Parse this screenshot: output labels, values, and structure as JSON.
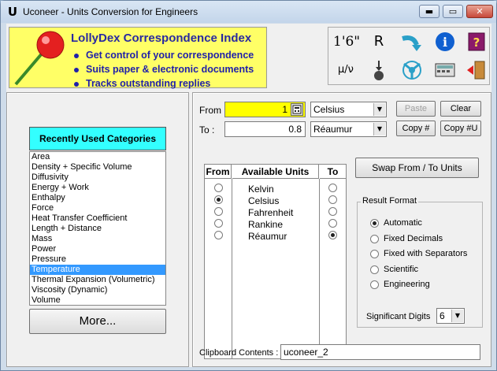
{
  "window": {
    "title": "Uconeer - Units Conversion for Engineers",
    "app_icon": "U",
    "controls": {
      "minimize": "▬",
      "maximize": "▭",
      "close": "✕"
    }
  },
  "banner": {
    "title": "LollyDex Correspondence Index",
    "items": [
      "Get control of your correspondence",
      "Suits paper & electronic documents",
      "Tracks outstanding replies"
    ]
  },
  "toolbar": {
    "icons": [
      {
        "name": "feet-inches-icon",
        "glyph": "1'6\""
      },
      {
        "name": "r-icon",
        "glyph": "R"
      },
      {
        "name": "curved-arrow-icon",
        "glyph": ""
      },
      {
        "name": "info-icon",
        "glyph": "i"
      },
      {
        "name": "help-book-icon",
        "glyph": "?"
      },
      {
        "name": "mu-over-nu-icon",
        "glyph": "μ/ν"
      },
      {
        "name": "pressure-gauge-icon",
        "glyph": ""
      },
      {
        "name": "fan-icon",
        "glyph": ""
      },
      {
        "name": "calculator-icon",
        "glyph": ""
      },
      {
        "name": "exit-icon",
        "glyph": ""
      }
    ]
  },
  "categories": {
    "header": "Recently Used Categories",
    "items": [
      "Area",
      "Density + Specific Volume",
      "Diffusivity",
      "Energy + Work",
      "Enthalpy",
      "Force",
      "Heat Transfer Coefficient",
      "Length + Distance",
      "Mass",
      "Power",
      "Pressure",
      "Temperature",
      "Thermal Expansion (Volumetric)",
      "Viscosity (Dynamic)",
      "Volume"
    ],
    "selected": "Temperature",
    "more_label": "More..."
  },
  "conversion": {
    "from_label": "From",
    "to_label": "To :",
    "from_value": "1",
    "to_value": "0.8",
    "from_unit": "Celsius",
    "to_unit": "Réaumur",
    "paste_label": "Paste",
    "clear_label": "Clear",
    "copy_label": "Copy #",
    "copy_u_label": "Copy #U",
    "from_color": "#ffff00"
  },
  "units": {
    "col_from": "From",
    "col_units": "Available Units",
    "col_to": "To",
    "items": [
      {
        "name": "Kelvin",
        "from": false,
        "to": false
      },
      {
        "name": "Celsius",
        "from": true,
        "to": false
      },
      {
        "name": "Fahrenheit",
        "from": false,
        "to": false
      },
      {
        "name": "Rankine",
        "from": false,
        "to": false
      },
      {
        "name": "Réaumur",
        "from": false,
        "to": true
      }
    ]
  },
  "swap": {
    "label": "Swap  From / To  Units"
  },
  "result_format": {
    "title": "Result Format",
    "options": [
      "Automatic",
      "Fixed Decimals",
      "Fixed with Separators",
      "Scientific",
      "Engineering"
    ],
    "selected": "Automatic",
    "sig_digits_label": "Significant Digits",
    "sig_digits_value": "6"
  },
  "clipboard": {
    "label": "Clipboard Contents :",
    "value": "uconeer_2"
  }
}
